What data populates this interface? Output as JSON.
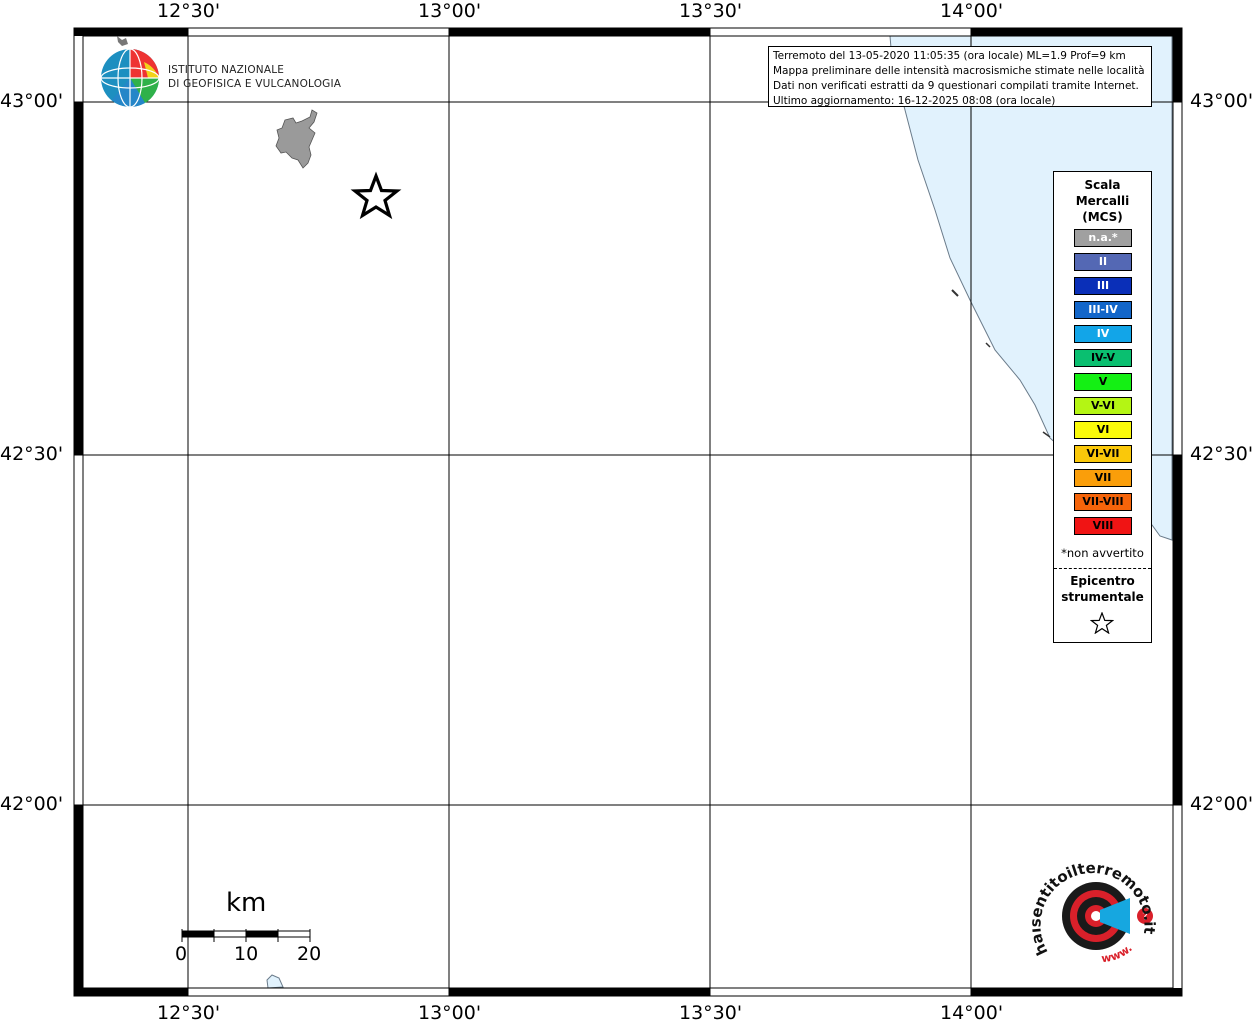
{
  "event_info": {
    "lines": [
      "Terremoto del 13-05-2020 11:05:35 (ora locale) ML=1.9 Prof=9 km",
      "Mappa preliminare delle intensità macrosismiche stimate nelle località",
      "Dati non verificati estratti da 9 questionari compilati tramite Internet.",
      "Ultimo aggiornamento: 16-12-2025 08:08 (ora locale)"
    ]
  },
  "institute": {
    "line1": "ISTITUTO NAZIONALE",
    "line2": "DI GEOFISICA E VULCANOLOGIA"
  },
  "axes": {
    "longitude_labels": [
      "12°30'",
      "13°00'",
      "13°30'",
      "14°00'"
    ],
    "latitude_labels": [
      "43°00'",
      "42°30'",
      "42°00'"
    ]
  },
  "legend": {
    "title_lines": [
      "Scala",
      "Mercalli",
      "(MCS)"
    ],
    "items": [
      {
        "label": "n.a.*",
        "color": "#a0a0a0",
        "text_color": "#ffffff"
      },
      {
        "label": "II",
        "color": "#5468b4",
        "text_color": "#ffffff"
      },
      {
        "label": "III",
        "color": "#0a2fb8",
        "text_color": "#ffffff"
      },
      {
        "label": "III-IV",
        "color": "#1266c9",
        "text_color": "#ffffff"
      },
      {
        "label": "IV",
        "color": "#12a5e8",
        "text_color": "#ffffff"
      },
      {
        "label": "IV-V",
        "color": "#0abf70",
        "text_color": "#000000"
      },
      {
        "label": "V",
        "color": "#14f014",
        "text_color": "#000000"
      },
      {
        "label": "V-VI",
        "color": "#b4f514",
        "text_color": "#000000"
      },
      {
        "label": "VI",
        "color": "#fafa0a",
        "text_color": "#000000"
      },
      {
        "label": "VI-VII",
        "color": "#fac80a",
        "text_color": "#000000"
      },
      {
        "label": "VII",
        "color": "#fa9e0a",
        "text_color": "#000000"
      },
      {
        "label": "VII-VIII",
        "color": "#f5640a",
        "text_color": "#000000"
      },
      {
        "label": "VIII",
        "color": "#f01414",
        "text_color": "#000000"
      }
    ],
    "note": "*non avvertito",
    "epicenter_lines": [
      "Epicentro",
      "strumentale"
    ]
  },
  "scale_bar": {
    "unit": "km",
    "ticks": [
      "0",
      "10",
      "20"
    ]
  },
  "website_logo": {
    "text": "haisentitoilterremoto.it",
    "www": "www."
  },
  "colors": {
    "sea": "#e1f2fd",
    "coast": "#6a7b8a",
    "place": "#9a9a9a",
    "frame": "#000000"
  }
}
